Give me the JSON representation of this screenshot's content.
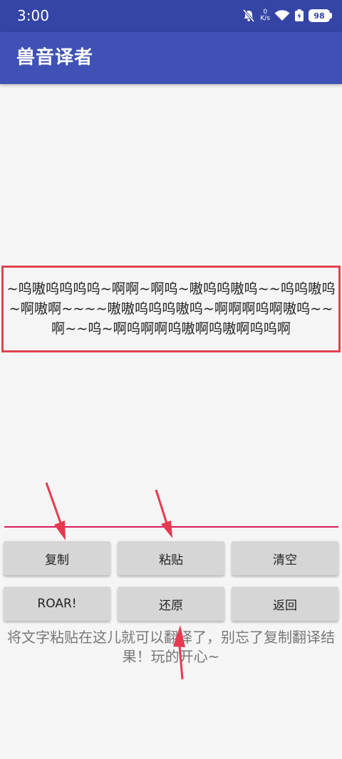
{
  "status_bar": {
    "time": "3:00",
    "net_speed_value": "0",
    "net_speed_unit": "K/s",
    "battery": "98",
    "icons": [
      "bell-muted-icon",
      "wifi-icon",
      "battery-saver-icon",
      "battery-icon"
    ]
  },
  "app_bar": {
    "title": "兽音译者"
  },
  "output": {
    "text": "~呜嗷呜呜呜呜~啊啊~啊呜~嗷呜呜嗷呜~~呜呜嗷呜~啊嗷啊~~~~嗷嗷呜呜呜嗷呜~啊啊啊呜啊嗷呜~~啊~~呜~啊呜啊啊呜嗷啊呜嗷啊呜呜啊"
  },
  "buttons": {
    "copy": "复制",
    "paste": "粘贴",
    "clear": "清空",
    "roar": "ROAR!",
    "restore": "还原",
    "back": "返回"
  },
  "hint": {
    "text": "将文字粘贴在这儿就可以翻译了，别忘了复制翻译结果！玩的开心~"
  },
  "colors": {
    "status_bar": "#3545a6",
    "app_bar": "#3f51b5",
    "output_border": "#e0434f",
    "input_line": "#d81b60",
    "arrows": "#e53950",
    "button_bg": "#d6d6d6"
  }
}
